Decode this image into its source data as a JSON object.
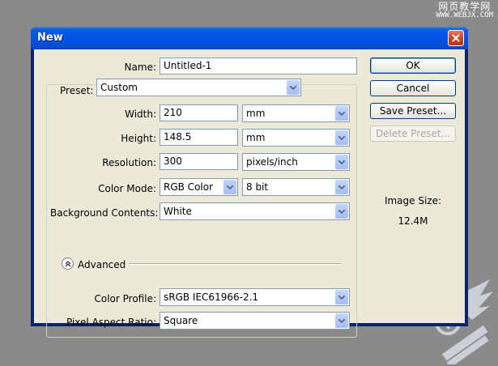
{
  "watermark_top": {
    "line1": "网页教学网",
    "line2": "WWW.WEBJX.COM"
  },
  "window": {
    "title": "New"
  },
  "form": {
    "name_label": "Name:",
    "name_value": "Untitled-1",
    "preset_label": "Preset:",
    "preset_value": "Custom",
    "width_label": "Width:",
    "width_value": "210",
    "width_unit": "mm",
    "height_label": "Height:",
    "height_value": "148.5",
    "height_unit": "mm",
    "resolution_label": "Resolution:",
    "resolution_value": "300",
    "resolution_unit": "pixels/inch",
    "color_mode_label": "Color Mode:",
    "color_mode_value": "RGB Color",
    "bit_depth_value": "8 bit",
    "background_label": "Background Contents:",
    "background_value": "White",
    "advanced_label": "Advanced",
    "color_profile_label": "Color Profile:",
    "color_profile_value": "sRGB IEC61966-2.1",
    "pixel_aspect_label": "Pixel Aspect Ratio:",
    "pixel_aspect_value": "Square"
  },
  "buttons": {
    "ok": "OK",
    "cancel": "Cancel",
    "save_preset": "Save Preset...",
    "delete_preset": "Delete Preset..."
  },
  "image_size": {
    "label": "Image Size:",
    "value": "12.4M"
  },
  "icons": {
    "close": "close-icon",
    "dropdown": "chevron-down-icon",
    "advanced_toggle": "chevron-up-double-icon"
  },
  "colors": {
    "titlebar": "#0054e3",
    "dialog_bg": "#ece9d8",
    "desktop": "#8a8a8a",
    "close_button": "#c8421e"
  }
}
